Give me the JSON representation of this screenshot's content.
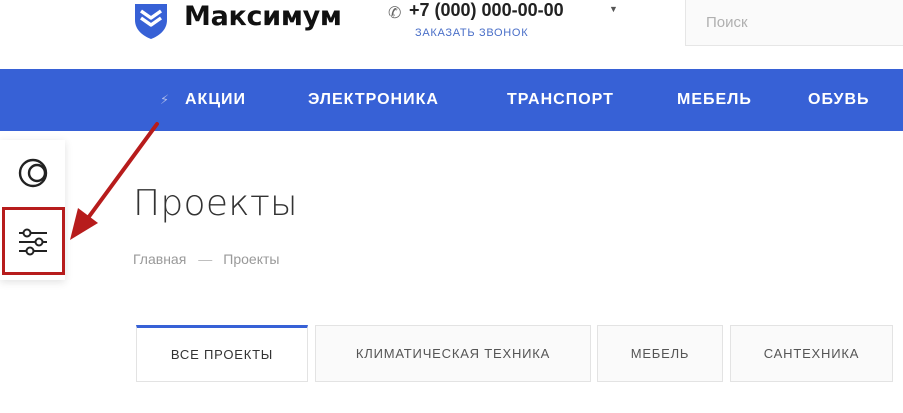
{
  "header": {
    "logo_text": "Максимум",
    "phone": "+7 (000) 000-00-00",
    "callback": "ЗАКАЗАТЬ ЗВОНОК",
    "search_placeholder": "Поиск"
  },
  "nav": {
    "items": [
      "АКЦИИ",
      "ЭЛЕКТРОНИКА",
      "ТРАНСПОРТ",
      "МЕБЕЛЬ",
      "ОБУВЬ"
    ]
  },
  "side_panel": {
    "buttons": [
      "theme-toggle",
      "settings"
    ]
  },
  "page": {
    "title": "Проекты",
    "breadcrumb": [
      "Главная",
      "—",
      "Проекты"
    ]
  },
  "tabs": {
    "items": [
      "ВСЕ ПРОЕКТЫ",
      "КЛИМАТИЧЕСКАЯ ТЕХНИКА",
      "МЕБЕЛЬ",
      "САНТЕХНИКА"
    ],
    "active": "ВСЕ ПРОЕКТЫ"
  },
  "colors": {
    "brand_blue": "#3761d6",
    "annotation_red": "#b71c1c"
  }
}
